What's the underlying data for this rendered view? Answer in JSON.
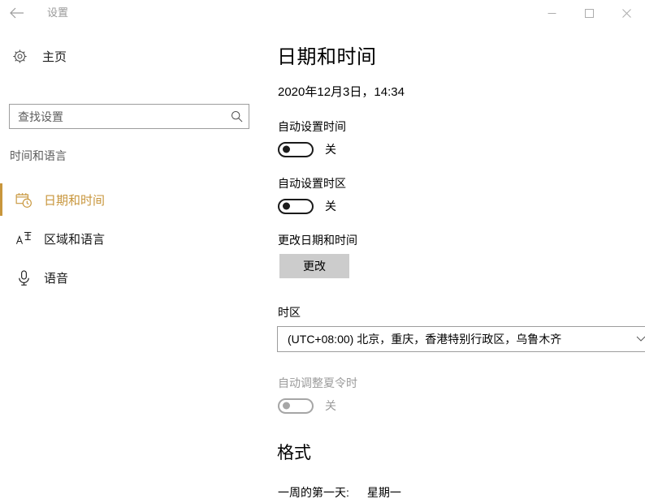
{
  "window": {
    "title": "设置",
    "back_icon": "back-arrow-icon",
    "controls": {
      "minimize": "minimize-icon",
      "maximize": "maximize-icon",
      "close": "close-icon"
    }
  },
  "accent_color": "#c8963c",
  "sidebar": {
    "home": {
      "label": "主页",
      "icon": "gear-icon"
    },
    "search": {
      "value": "",
      "placeholder": "查找设置",
      "icon": "search-icon"
    },
    "group_title": "时间和语言",
    "items": [
      {
        "label": "日期和时间",
        "icon": "calendar-clock-icon",
        "selected": true
      },
      {
        "label": "区域和语言",
        "icon": "language-icon",
        "selected": false
      },
      {
        "label": "语音",
        "icon": "microphone-icon",
        "selected": false
      }
    ]
  },
  "main": {
    "page_title": "日期和时间",
    "current_datetime": "2020年12月3日，14:34",
    "auto_time": {
      "label": "自动设置时间",
      "state": "关",
      "enabled": true
    },
    "auto_timezone": {
      "label": "自动设置时区",
      "state": "关",
      "enabled": true
    },
    "change_datetime": {
      "label": "更改日期和时间",
      "button": "更改"
    },
    "timezone": {
      "label": "时区",
      "value": "(UTC+08:00) 北京，重庆，香港特别行政区，乌鲁木齐",
      "chevron": "chevron-down-icon"
    },
    "dst": {
      "label": "自动调整夏令时",
      "state": "关",
      "enabled": false
    },
    "format_section": {
      "title": "格式",
      "first_day_label": "一周的第一天:",
      "first_day_value": "星期一"
    }
  }
}
